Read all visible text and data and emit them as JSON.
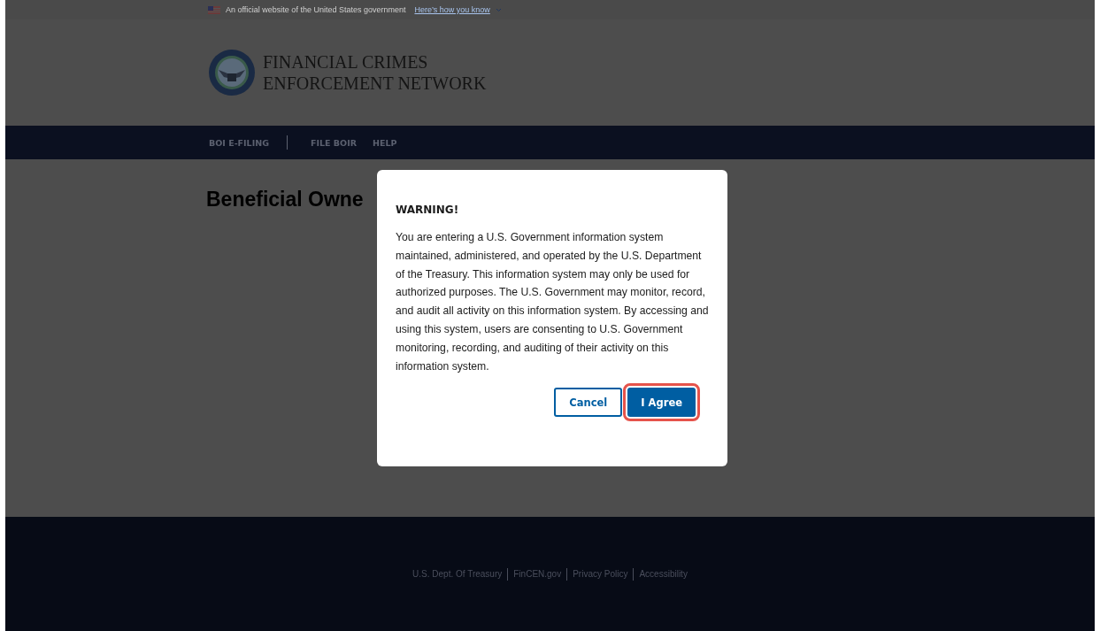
{
  "banner": {
    "text": "An official website of the United States government",
    "link": "Here’s how you know"
  },
  "header": {
    "title_lines": [
      "FINANCIAL CRIMES",
      "ENFORCEMENT NETWORK"
    ]
  },
  "nav": {
    "items": [
      {
        "label": "BOI E-FILING"
      },
      {
        "label": "FILE BOIR"
      },
      {
        "label": "HELP"
      }
    ]
  },
  "main": {
    "heading": "Beneficial Owne"
  },
  "modal": {
    "title": "WARNING!",
    "body": "You are entering a U.S. Government information system maintained, administered, and operated by the U.S. Department of the Treasury. This information system may only be used for authorized purposes. The U.S. Government may monitor, record, and audit all activity on this information system. By accessing and using this system, users are consenting to U.S. Government monitoring, recording, and auditing of their activity on this information system.",
    "buttons": [
      {
        "label": "Cancel",
        "kind": "outline",
        "highlighted": false
      },
      {
        "label": "I Agree",
        "kind": "primary",
        "highlighted": true
      }
    ]
  },
  "footer": {
    "links": [
      "U.S. Dept. Of Treasury",
      "FinCEN.gov",
      "Privacy Policy",
      "Accessibility"
    ]
  }
}
